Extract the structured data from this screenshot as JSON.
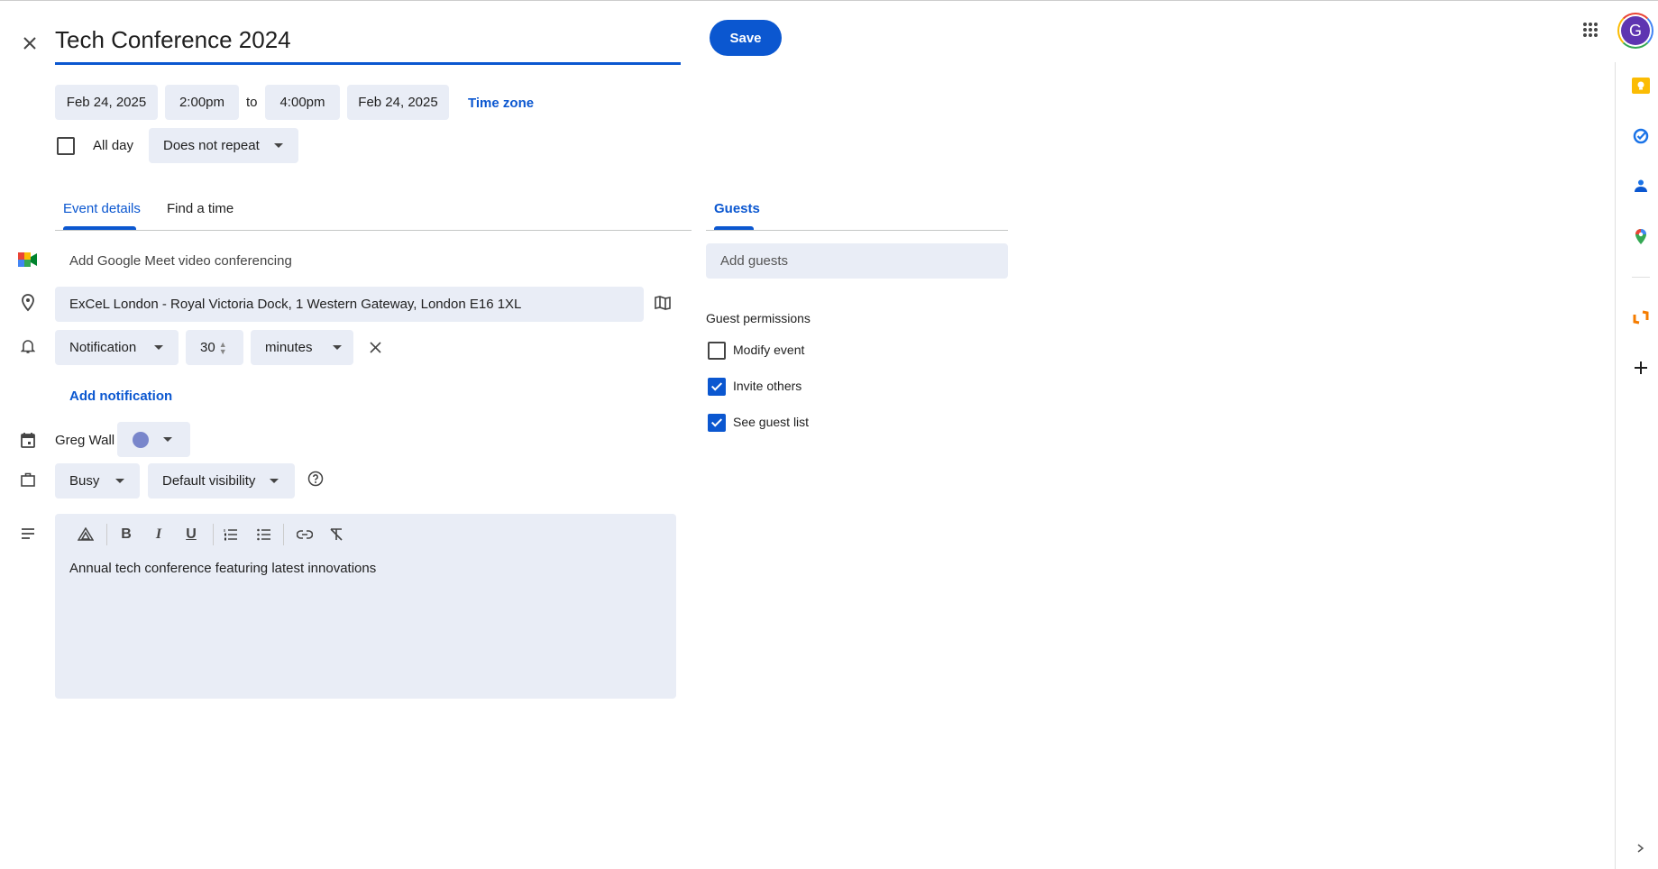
{
  "header": {
    "event_title": "Tech Conference 2024",
    "save_label": "Save",
    "avatar_letter": "G"
  },
  "datetime": {
    "start_date": "Feb 24, 2025",
    "start_time": "2:00pm",
    "to_label": "to",
    "end_time": "4:00pm",
    "end_date": "Feb 24, 2025",
    "time_zone_label": "Time zone",
    "all_day_label": "All day",
    "all_day_checked": false,
    "repeat": "Does not repeat"
  },
  "tabs": [
    {
      "label": "Event details",
      "active": true
    },
    {
      "label": "Find a time",
      "active": false
    }
  ],
  "details": {
    "meet_label": "Add Google Meet video conferencing",
    "location": "ExCeL London - Royal Victoria Dock, 1 Western Gateway, London E16 1XL",
    "notification_type": "Notification",
    "notification_value": "30",
    "notification_unit": "minutes",
    "add_notification_label": "Add notification",
    "calendar_owner": "Greg Wall",
    "calendar_color": "#7986cb",
    "availability": "Busy",
    "visibility": "Default visibility",
    "description": "Annual tech conference featuring latest innovations"
  },
  "guests": {
    "tab_label": "Guests",
    "add_placeholder": "Add guests",
    "permissions_title": "Guest permissions",
    "permissions": [
      {
        "label": "Modify event",
        "checked": false
      },
      {
        "label": "Invite others",
        "checked": true
      },
      {
        "label": "See guest list",
        "checked": true
      }
    ]
  },
  "colors": {
    "accent": "#0b57d0",
    "field_bg": "#e9edf6"
  },
  "side_panel": [
    "keep-icon",
    "tasks-icon",
    "contacts-icon",
    "maps-icon",
    "addon-icon",
    "add-icon"
  ]
}
